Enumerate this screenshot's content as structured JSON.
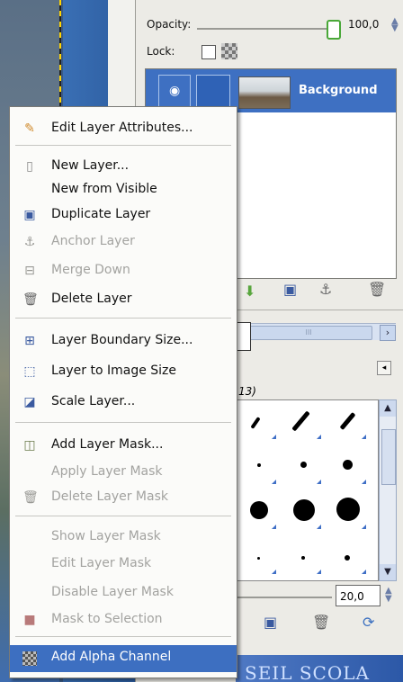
{
  "dock": {
    "opacity_label": "Opacity:",
    "opacity_value": "100,0",
    "lock_label": "Lock:",
    "layer_name": "Background",
    "brushes_title_fragment": "13)",
    "spacing_value": "20,0",
    "scroll_hint": "III"
  },
  "background_text": "SEIL SCOLA",
  "menu": {
    "items": [
      {
        "label": "Edit Layer Attributes...",
        "icon": "edit-attributes-icon",
        "enabled": true
      },
      {
        "label": "New Layer...",
        "icon": "new-layer-icon",
        "enabled": true
      },
      {
        "label": "New from Visible",
        "icon": "",
        "enabled": true
      },
      {
        "label": "Duplicate Layer",
        "icon": "duplicate-layer-icon",
        "enabled": true
      },
      {
        "label": "Anchor Layer",
        "icon": "anchor-icon",
        "enabled": false
      },
      {
        "label": "Merge Down",
        "icon": "merge-down-icon",
        "enabled": false
      },
      {
        "label": "Delete Layer",
        "icon": "trash-icon",
        "enabled": true
      },
      {
        "label": "Layer Boundary Size...",
        "icon": "layer-boundary-icon",
        "enabled": true
      },
      {
        "label": "Layer to Image Size",
        "icon": "layer-to-image-icon",
        "enabled": true
      },
      {
        "label": "Scale Layer...",
        "icon": "scale-layer-icon",
        "enabled": true
      },
      {
        "label": "Add Layer Mask...",
        "icon": "layer-mask-icon",
        "enabled": true
      },
      {
        "label": "Apply Layer Mask",
        "icon": "",
        "enabled": false
      },
      {
        "label": "Delete Layer Mask",
        "icon": "trash-icon",
        "enabled": false
      },
      {
        "label": "Show Layer Mask",
        "icon": "",
        "enabled": false
      },
      {
        "label": "Edit Layer Mask",
        "icon": "",
        "enabled": false
      },
      {
        "label": "Disable Layer Mask",
        "icon": "",
        "enabled": false
      },
      {
        "label": "Mask to Selection",
        "icon": "mask-to-selection-icon",
        "enabled": false
      },
      {
        "label": "Add Alpha Channel",
        "icon": "alpha-channel-icon",
        "enabled": true,
        "highlighted": true
      }
    ]
  },
  "colors": {
    "highlight": "#3d6fc1",
    "disabled_text": "#a3a3a0"
  }
}
